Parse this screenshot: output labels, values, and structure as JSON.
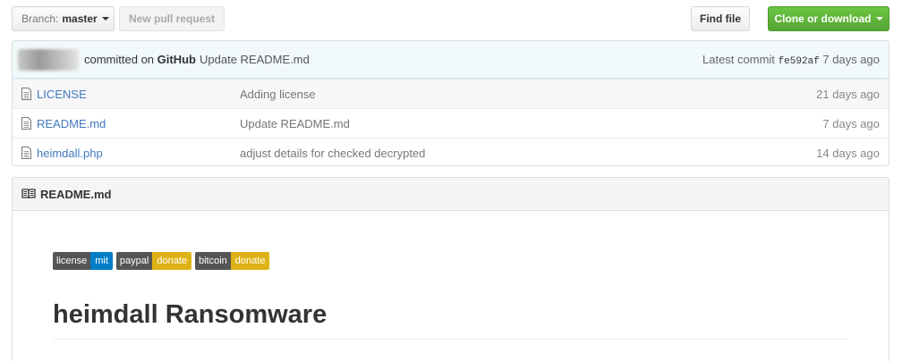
{
  "toolbar": {
    "branch_prefix": "Branch:",
    "branch_name": "master",
    "new_pr_label": "New pull request",
    "find_file_label": "Find file",
    "clone_label": "Clone or download"
  },
  "commit": {
    "committed_text": "committed on",
    "via": "GitHub",
    "message": "Update README.md",
    "latest_label": "Latest commit",
    "sha": "fe592af",
    "age": "7 days ago"
  },
  "files": [
    {
      "name": "LICENSE",
      "message": "Adding license",
      "age": "21 days ago"
    },
    {
      "name": "README.md",
      "message": "Update README.md",
      "age": "7 days ago"
    },
    {
      "name": "heimdall.php",
      "message": "adjust details for checked decrypted",
      "age": "14 days ago"
    }
  ],
  "readme": {
    "title": "README.md",
    "badges": [
      {
        "left": "license",
        "right": "mit",
        "color": "#007ec6"
      },
      {
        "left": "paypal",
        "right": "donate",
        "color": "#dfb317"
      },
      {
        "left": "bitcoin",
        "right": "donate",
        "color": "#dfb317"
      }
    ],
    "heading": "heimdall Ransomware"
  },
  "colors": {
    "link": "#4078c0",
    "clone_green": "#6cc644",
    "commit_bar": "#f2f9fc"
  }
}
